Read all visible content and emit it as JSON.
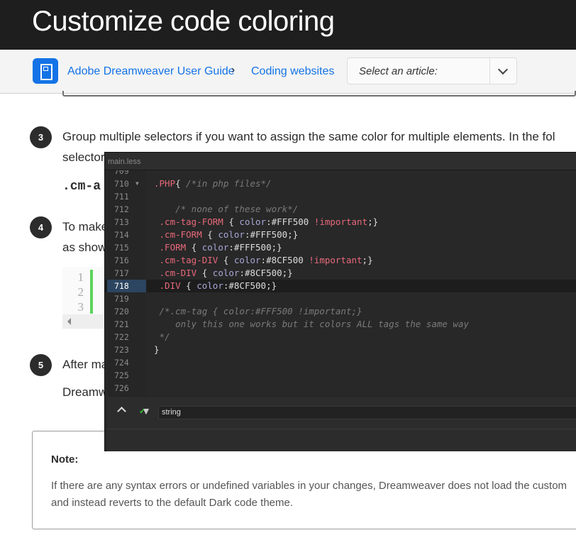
{
  "page": {
    "title": "Customize code coloring"
  },
  "nav": {
    "breadcrumbs": [
      "Adobe Dreamweaver User Guide",
      "Coding websites"
    ],
    "select_placeholder": "Select an article:"
  },
  "steps": [
    {
      "number": "3",
      "lines": [
        "Group multiple selectors if you want to assign the same color for multiple elements. In the fol",
        "selector"
      ],
      "code": ".cm-a"
    },
    {
      "number": "4",
      "lines": [
        "To make",
        "as show"
      ]
    },
    {
      "number": "5",
      "lines": [
        "After ma",
        "Dreamw"
      ]
    }
  ],
  "code_block": {
    "line_numbers": [
      "1",
      "2",
      "3"
    ]
  },
  "note": {
    "title": "Note:",
    "body": [
      "If there are any syntax errors or undefined variables in your changes, Dreamweaver does not load the custom",
      "and instead reverts to the default Dark code theme."
    ]
  },
  "editor": {
    "filename": "main.less",
    "active_line": "718",
    "lines": [
      {
        "n": "709",
        "parts": []
      },
      {
        "n": "710",
        "fold": true,
        "parts": [
          [
            "sel",
            ".PHP"
          ],
          [
            "br",
            "{ "
          ],
          [
            "cm",
            "/*in php files*/"
          ]
        ]
      },
      {
        "n": "711",
        "parts": []
      },
      {
        "n": "712",
        "parts": [
          [
            "cm",
            "    /* none of these work*/"
          ]
        ]
      },
      {
        "n": "713",
        "parts": [
          [
            "sel",
            " .cm-tag-FORM "
          ],
          [
            "br",
            "{ "
          ],
          [
            "prop",
            "color"
          ],
          [
            "val",
            ":#FFF500 "
          ],
          [
            "imp",
            "!important"
          ],
          [
            "br",
            ";}"
          ]
        ]
      },
      {
        "n": "714",
        "parts": [
          [
            "sel",
            " .cm-FORM "
          ],
          [
            "br",
            "{ "
          ],
          [
            "prop",
            "color"
          ],
          [
            "val",
            ":#FFF500;}"
          ]
        ]
      },
      {
        "n": "715",
        "parts": [
          [
            "sel",
            " .FORM "
          ],
          [
            "br",
            "{ "
          ],
          [
            "prop",
            "color"
          ],
          [
            "val",
            ":#FFF500;}"
          ]
        ]
      },
      {
        "n": "716",
        "parts": [
          [
            "sel",
            " .cm-tag-DIV "
          ],
          [
            "br",
            "{ "
          ],
          [
            "prop",
            "color"
          ],
          [
            "val",
            ":#8CF500 "
          ],
          [
            "imp",
            "!important"
          ],
          [
            "br",
            ";}"
          ]
        ]
      },
      {
        "n": "717",
        "parts": [
          [
            "sel",
            " .cm-DIV "
          ],
          [
            "br",
            "{ "
          ],
          [
            "prop",
            "color"
          ],
          [
            "val",
            ":#8CF500;}"
          ]
        ]
      },
      {
        "n": "718",
        "parts": [
          [
            "sel",
            " .DIV "
          ],
          [
            "br",
            "{ "
          ],
          [
            "prop",
            "color"
          ],
          [
            "val",
            ":#8CF500;}"
          ]
        ]
      },
      {
        "n": "719",
        "parts": []
      },
      {
        "n": "720",
        "parts": [
          [
            "cm",
            " /*.cm-tag { color:#FFF500 !important;}"
          ]
        ]
      },
      {
        "n": "721",
        "parts": [
          [
            "cm",
            "    only this one works but it colors ALL tags the same way"
          ]
        ]
      },
      {
        "n": "722",
        "parts": [
          [
            "cm",
            " */"
          ]
        ]
      },
      {
        "n": "723",
        "parts": [
          [
            "br",
            "}"
          ]
        ]
      },
      {
        "n": "724",
        "parts": []
      },
      {
        "n": "725",
        "parts": []
      },
      {
        "n": "726",
        "parts": []
      }
    ],
    "search_value": "string"
  },
  "colors": {
    "accent": "#1473e6",
    "header_bg": "#1e1e1e",
    "editor_bg": "#282828",
    "selector": "#e8697a",
    "gutter_bar": "#5bd35b"
  }
}
